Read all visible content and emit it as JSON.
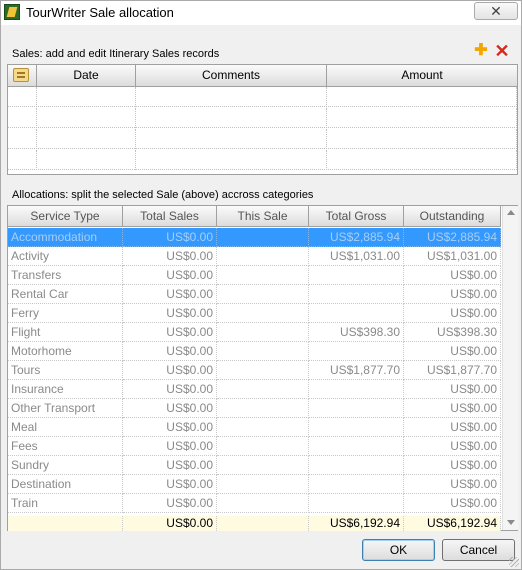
{
  "window": {
    "title": "TourWriter Sale allocation",
    "close_symbol": "✕"
  },
  "sales": {
    "label": "Sales: add and edit Itinerary Sales records",
    "add_symbol": "✚",
    "delete_symbol": "✕",
    "columns": [
      "Date",
      "Comments",
      "Amount"
    ],
    "empty_rows": 4
  },
  "allocations": {
    "label": "Allocations: split the selected Sale (above) accross categories",
    "columns": [
      "Service Type",
      "Total Sales",
      "This Sale",
      "Total Gross",
      "Outstanding"
    ],
    "rows": [
      {
        "service_type": "Accommodation",
        "total_sales": "US$0.00",
        "this_sale": "",
        "total_gross": "US$2,885.94",
        "outstanding": "US$2,885.94"
      },
      {
        "service_type": "Activity",
        "total_sales": "US$0.00",
        "this_sale": "",
        "total_gross": "US$1,031.00",
        "outstanding": "US$1,031.00"
      },
      {
        "service_type": "Transfers",
        "total_sales": "US$0.00",
        "this_sale": "",
        "total_gross": "",
        "outstanding": "US$0.00"
      },
      {
        "service_type": "Rental Car",
        "total_sales": "US$0.00",
        "this_sale": "",
        "total_gross": "",
        "outstanding": "US$0.00"
      },
      {
        "service_type": "Ferry",
        "total_sales": "US$0.00",
        "this_sale": "",
        "total_gross": "",
        "outstanding": "US$0.00"
      },
      {
        "service_type": "Flight",
        "total_sales": "US$0.00",
        "this_sale": "",
        "total_gross": "US$398.30",
        "outstanding": "US$398.30"
      },
      {
        "service_type": "Motorhome",
        "total_sales": "US$0.00",
        "this_sale": "",
        "total_gross": "",
        "outstanding": "US$0.00"
      },
      {
        "service_type": "Tours",
        "total_sales": "US$0.00",
        "this_sale": "",
        "total_gross": "US$1,877.70",
        "outstanding": "US$1,877.70"
      },
      {
        "service_type": "Insurance",
        "total_sales": "US$0.00",
        "this_sale": "",
        "total_gross": "",
        "outstanding": "US$0.00"
      },
      {
        "service_type": "Other Transport",
        "total_sales": "US$0.00",
        "this_sale": "",
        "total_gross": "",
        "outstanding": "US$0.00"
      },
      {
        "service_type": "Meal",
        "total_sales": "US$0.00",
        "this_sale": "",
        "total_gross": "",
        "outstanding": "US$0.00"
      },
      {
        "service_type": "Fees",
        "total_sales": "US$0.00",
        "this_sale": "",
        "total_gross": "",
        "outstanding": "US$0.00"
      },
      {
        "service_type": "Sundry",
        "total_sales": "US$0.00",
        "this_sale": "",
        "total_gross": "",
        "outstanding": "US$0.00"
      },
      {
        "service_type": "Destination",
        "total_sales": "US$0.00",
        "this_sale": "",
        "total_gross": "",
        "outstanding": "US$0.00"
      },
      {
        "service_type": "Train",
        "total_sales": "US$0.00",
        "this_sale": "",
        "total_gross": "",
        "outstanding": "US$0.00"
      }
    ],
    "selected_index": 0,
    "totals": {
      "total_sales": "US$0.00",
      "this_sale": "",
      "total_gross": "US$6,192.94",
      "outstanding": "US$6,192.94"
    }
  },
  "buttons": {
    "ok": "OK",
    "cancel": "Cancel"
  }
}
